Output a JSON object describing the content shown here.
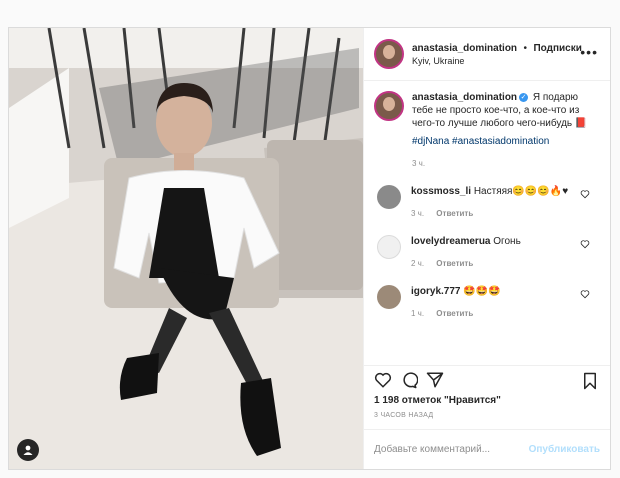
{
  "post": {
    "header": {
      "username": "anastasia_domination",
      "separator": "•",
      "follow_label": "Подписки",
      "location": "Kyiv, Ukraine",
      "more_icon": "more-horizontal-icon"
    },
    "caption": {
      "username": "anastasia_domination",
      "text": "Я подарю тебе не просто кое-что, а кое-что из чего-то лучше любого чего-нибудь 📕",
      "hashtags": "#djNana #anastasiadomination",
      "time": "3 ч."
    },
    "comments": [
      {
        "username": "kossmoss_li",
        "text": "Настяяя😊😊😊🔥♥",
        "time": "3 ч.",
        "reply_label": "Ответить"
      },
      {
        "username": "lovelydreamerua",
        "text": "Огонь",
        "time": "2 ч.",
        "reply_label": "Ответить"
      },
      {
        "username": "igoryk.777",
        "text": "🤩🤩🤩",
        "time": "1 ч.",
        "reply_label": "Ответить"
      }
    ],
    "likes": "1 198 отметок \"Нравится\"",
    "timestamp": "3 ЧАСОВ НАЗАД",
    "add_comment_placeholder": "Добавьте комментарий...",
    "publish_label": "Опубликовать",
    "colors": {
      "link": "#00376b",
      "publish_disabled": "#b2dffc",
      "verified": "#3897f0",
      "muted": "#8e8e8e"
    }
  }
}
